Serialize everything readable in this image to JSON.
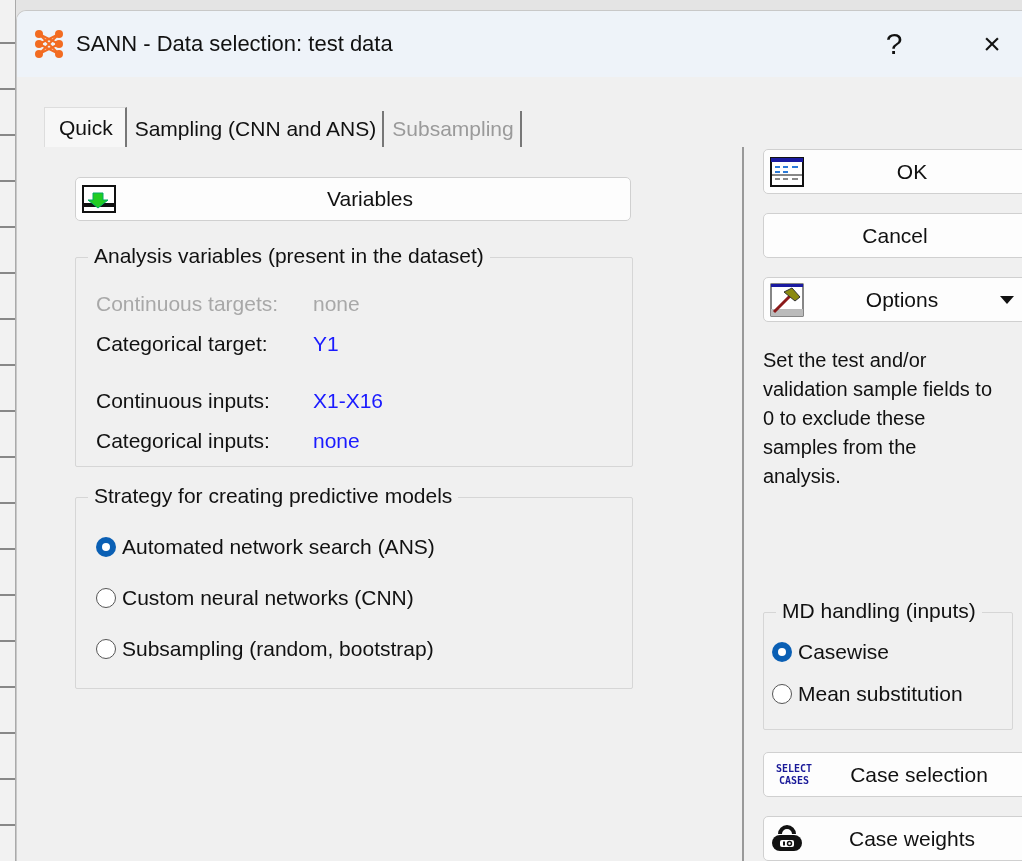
{
  "window": {
    "title": "SANN - Data selection: test data",
    "help": "?",
    "close": "×"
  },
  "tabs": [
    {
      "label": "Quick",
      "selected": true,
      "disabled": false
    },
    {
      "label": "Sampling (CNN and ANS)",
      "selected": false,
      "disabled": false
    },
    {
      "label": "Subsampling",
      "selected": false,
      "disabled": true
    }
  ],
  "variables_button": {
    "label": "Variables"
  },
  "analysis_group": {
    "title": "Analysis variables (present in the dataset)",
    "rows": [
      {
        "label": "Continuous targets:",
        "value": "none",
        "disabled": true
      },
      {
        "label": "Categorical target:",
        "value": "Y1",
        "disabled": false
      },
      {
        "label": "Continuous inputs:",
        "value": "X1-X16",
        "disabled": false
      },
      {
        "label": "Categorical inputs:",
        "value": "none",
        "disabled": false
      }
    ]
  },
  "strategy_group": {
    "title": "Strategy for creating predictive models",
    "options": [
      {
        "label": "Automated network search (ANS)",
        "selected": true
      },
      {
        "label": "Custom neural networks (CNN)",
        "selected": false
      },
      {
        "label": "Subsampling (random, bootstrap)",
        "selected": false
      }
    ]
  },
  "side_buttons": [
    {
      "kind": "ok",
      "label": "OK"
    },
    {
      "kind": "cancel",
      "label": "Cancel"
    },
    {
      "kind": "options",
      "label": "Options"
    }
  ],
  "note": "Set the test and/or validation sample fields to 0 to exclude these samples from the analysis.",
  "md_group": {
    "title": "MD handling (inputs)",
    "options": [
      {
        "label": "Casewise",
        "selected": true
      },
      {
        "label": "Mean substitution",
        "selected": false
      }
    ]
  },
  "bottom_buttons": [
    {
      "kind": "select-cases",
      "label": "Case selection",
      "icon_text": "SELECT CASES"
    },
    {
      "kind": "weights",
      "label": "Case weights"
    }
  ]
}
